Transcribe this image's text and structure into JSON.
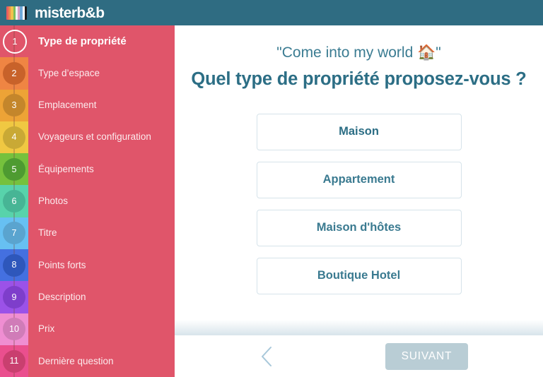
{
  "brand": {
    "name": "misterb&b",
    "mark_colors": [
      "#e8605f",
      "#ef8b4e",
      "#f2c14e",
      "#7dbf5a",
      "#f2f2f2",
      "#d9a0c4",
      "#6fa9d8",
      "#ffffff",
      "#1a1a1a"
    ],
    "bar_color": "#2f6c82"
  },
  "sidebar": {
    "background": "#e0556a",
    "steps": [
      {
        "number": "1",
        "label": "Type de propriété",
        "swatch": "#e0556a",
        "badge": "#e0556a",
        "active": true
      },
      {
        "number": "2",
        "label": "Type d’espace",
        "swatch": "#ef8543",
        "badge": "#c8622a",
        "active": false
      },
      {
        "number": "3",
        "label": "Emplacement",
        "swatch": "#eda336",
        "badge": "#c4862b",
        "active": false
      },
      {
        "number": "4",
        "label": "Voyageurs et configuration",
        "swatch": "#f0c842",
        "badge": "#c9a935",
        "active": false
      },
      {
        "number": "5",
        "label": "Équipements",
        "swatch": "#76c13d",
        "badge": "#4e9b31",
        "active": false
      },
      {
        "number": "6",
        "label": "Photos",
        "swatch": "#58d3ab",
        "badge": "#47b595",
        "active": false
      },
      {
        "number": "7",
        "label": "Titre",
        "swatch": "#67c0f2",
        "badge": "#5aa4cf",
        "active": false
      },
      {
        "number": "8",
        "label": "Points forts",
        "swatch": "#4470e0",
        "badge": "#2e57bb",
        "active": false
      },
      {
        "number": "9",
        "label": "Description",
        "swatch": "#9b52e8",
        "badge": "#7e3ecb",
        "active": false
      },
      {
        "number": "10",
        "label": "Prix",
        "swatch": "#ef8ed2",
        "badge": "#d07cb8",
        "active": false
      },
      {
        "number": "11",
        "label": "Dernière question",
        "swatch": "#ea4f8e",
        "badge": "#c93f6f",
        "active": false
      }
    ]
  },
  "main": {
    "subtitle": "\"Come into my world 🏠\"",
    "question": "Quel type de propriété proposez-vous ?",
    "options": [
      {
        "label": "Maison",
        "selected": true
      },
      {
        "label": "Appartement",
        "selected": false
      },
      {
        "label": "Maison d'hôtes",
        "selected": false
      },
      {
        "label": "Boutique Hotel",
        "selected": false
      }
    ]
  },
  "footer": {
    "back_icon": "chevron-left-icon",
    "next_label": "SUIVANT",
    "next_color": "#b9cdd5",
    "next_enabled": false
  }
}
